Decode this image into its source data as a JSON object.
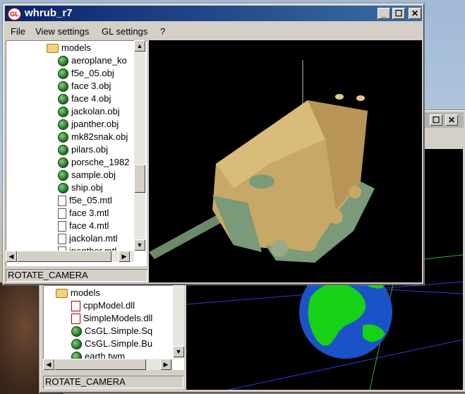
{
  "back_window": {
    "tree_items": [
      {
        "label": "models",
        "icon": "folder-icon"
      },
      {
        "label": "cppModel.dll",
        "icon": "dll-icon"
      },
      {
        "label": "SimpleModels.dll",
        "icon": "dll-icon"
      },
      {
        "label": "CsGL.Simple.Sq",
        "icon": "globe-icon"
      },
      {
        "label": "CsGL.Simple.Bu",
        "icon": "globe-icon"
      },
      {
        "label": "earth.twm",
        "icon": "globe-icon"
      }
    ],
    "status": "ROTATE_CAMERA"
  },
  "main_window": {
    "title": "whrub_r7",
    "menu": [
      "File",
      "View settings",
      "GL settings",
      "?"
    ],
    "tree_items": [
      {
        "label": "models",
        "icon": "folder-icon"
      },
      {
        "label": "aeroplane_ko",
        "icon": "globe-icon"
      },
      {
        "label": "f5e_05.obj",
        "icon": "globe-icon"
      },
      {
        "label": "face 3.obj",
        "icon": "globe-icon"
      },
      {
        "label": "face 4.obj",
        "icon": "globe-icon"
      },
      {
        "label": "jackolan.obj",
        "icon": "globe-icon"
      },
      {
        "label": "jpanther.obj",
        "icon": "globe-icon"
      },
      {
        "label": "mk82snak.obj",
        "icon": "globe-icon"
      },
      {
        "label": "pilars.obj",
        "icon": "globe-icon"
      },
      {
        "label": "porsche_1982",
        "icon": "globe-icon"
      },
      {
        "label": "sample.obj",
        "icon": "globe-icon"
      },
      {
        "label": "ship.obj",
        "icon": "globe-icon"
      },
      {
        "label": "f5e_05.mtl",
        "icon": "document-icon"
      },
      {
        "label": "face 3.mtl",
        "icon": "document-icon"
      },
      {
        "label": "face 4.mtl",
        "icon": "document-icon"
      },
      {
        "label": "jackolan.mtl",
        "icon": "document-icon"
      },
      {
        "label": "jpanther.mtl",
        "icon": "document-icon"
      }
    ],
    "status": "ROTATE_CAMERA"
  },
  "colors": {
    "title_active": "#0a246a",
    "viewport_bg": "#000000",
    "tank_body": "#c8a866",
    "tank_gun": "#6b8a6b"
  }
}
